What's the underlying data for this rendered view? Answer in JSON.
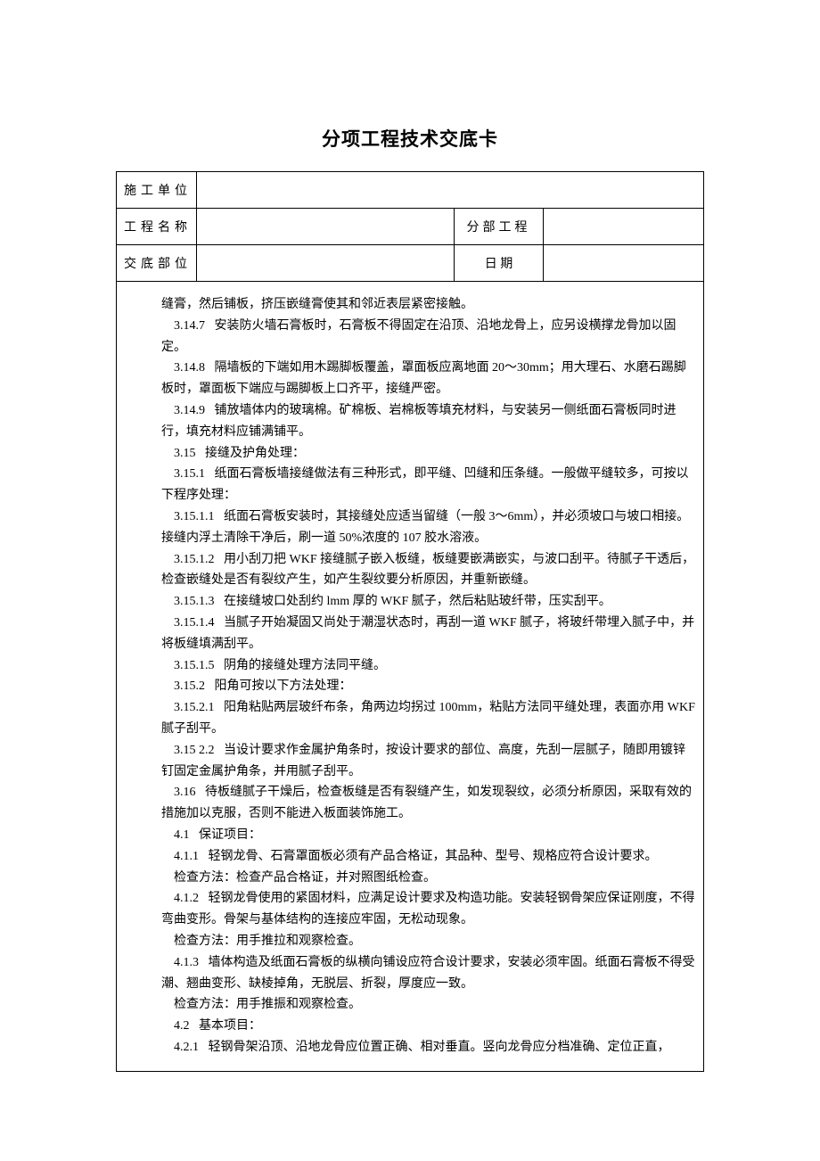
{
  "title": "分项工程技术交底卡",
  "header": {
    "row1": {
      "label": "施工单位",
      "value": ""
    },
    "row2": {
      "label_left": "工程名称",
      "value_left": "",
      "label_right": "分部工程",
      "value_right": ""
    },
    "row3": {
      "label_left": "交底部位",
      "value_left": "",
      "label_right": "日    期",
      "value_right": ""
    }
  },
  "body": [
    "缝膏，然后铺板，挤压嵌缝膏使其和邻近表层紧密接触。",
    "    3.14.7   安装防火墙石膏板时，石膏板不得固定在沿顶、沿地龙骨上，应另设横撑龙骨加以固定。",
    "    3.14.8   隔墙板的下端如用木踢脚板覆盖，罩面板应离地面 20～30mm；用大理石、水磨石踢脚板时，罩面板下端应与踢脚板上口齐平，接缝严密。",
    "    3.14.9   铺放墙体内的玻璃棉。矿棉板、岩棉板等填充材料，与安装另一侧纸面石膏板同时进行，填充材料应铺满铺平。",
    "    3.15   接缝及护角处理：",
    "    3.15.1   纸面石膏板墙接缝做法有三种形式，即平缝、凹缝和压条缝。一般做平缝较多，可按以下程序处理：",
    "    3.15.1.1   纸面石膏板安装时，其接缝处应适当留缝（一般 3～6mm），并必须坡口与坡口相接。接缝内浮土清除干净后，刷一道 50%浓度的 107 胶水溶液。",
    "    3.15.1.2   用小刮刀把 WKF 接缝腻子嵌入板缝，板缝要嵌满嵌实，与波口刮平。待腻子干透后，检查嵌缝处是否有裂纹产生，如产生裂纹要分析原因，并重新嵌缝。",
    "    3.15.1.3   在接缝坡口处刮约 lmm 厚的 WKF 腻子，然后粘贴玻纤带，压实刮平。",
    "    3.15.1.4   当腻子开始凝固又尚处于潮湿状态时，再刮一道 WKF 腻子，将玻纤带埋入腻子中，并将板缝填满刮平。",
    "    3.15.1.5   阴角的接缝处理方法同平缝。",
    "    3.15.2   阳角可按以下方法处理：",
    "    3.15.2.1   阳角粘贴两层玻纤布条，角两边均拐过 100mm，粘贴方法同平缝处理，表面亦用 WKF腻子刮平。",
    "    3.15 2.2   当设计要求作金属护角条时，按设计要求的部位、高度，先刮一层腻子，随即用镀锌钉固定金属护角条，并用腻子刮平。",
    "    3.16   待板缝腻子干燥后，检查板缝是否有裂缝产生，如发现裂纹，必须分析原因，采取有效的措施加以克服，否则不能进入板面装饰施工。",
    "    4.1   保证项目：",
    "    4.1.1   轻钢龙骨、石膏罩面板必须有产品合格证，其品种、型号、规格应符合设计要求。",
    "    检查方法：检查产品合格证，并对照图纸检查。",
    "    4.1.2   轻钢龙骨使用的紧固材料，应满足设计要求及构造功能。安装轻钢骨架应保证刚度，不得弯曲变形。骨架与基体结构的连接应牢固，无松动现象。",
    "    检查方法：用手推拉和观察检查。",
    "    4.1.3   墙体构造及纸面石膏板的纵横向铺设应符合设计要求，安装必须牢固。纸面石膏板不得受潮、翘曲变形、缺棱掉角，无脱层、折裂，厚度应一致。",
    "    检查方法：用手推振和观察检查。",
    "    4.2   基本项目：",
    "    4.2.1   轻钢骨架沿顶、沿地龙骨应位置正确、相对垂直。竖向龙骨应分档准确、定位正直，"
  ]
}
